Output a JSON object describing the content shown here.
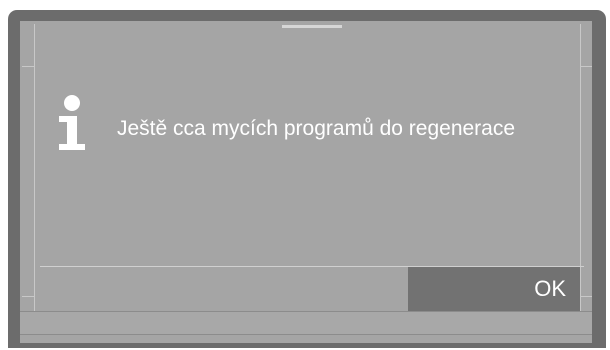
{
  "dialog": {
    "icon": "info-icon",
    "message": "Ještě cca  mycích programů do regenerace",
    "ok_label": "OK"
  },
  "colors": {
    "bezel": "#6c6c6c",
    "screen": "#a5a5a5",
    "ok_button": "#727272",
    "text": "#ffffff"
  }
}
